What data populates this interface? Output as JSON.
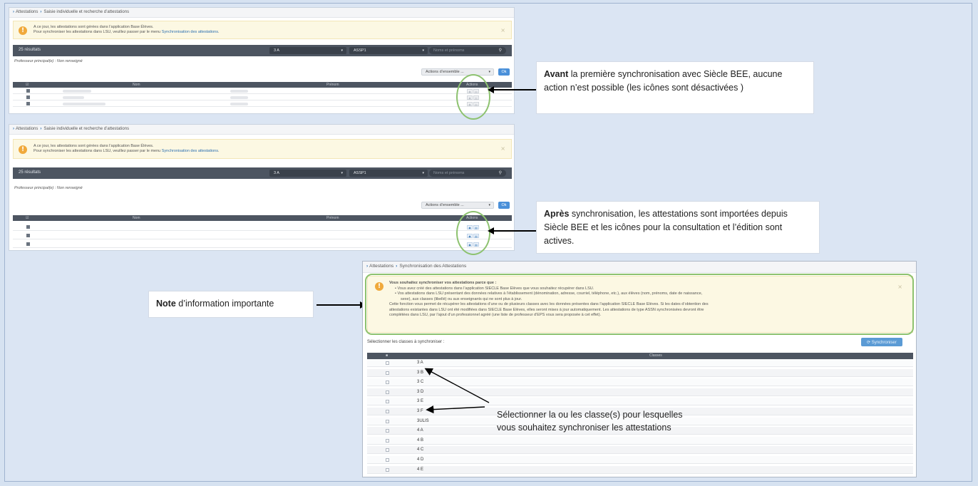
{
  "panel": {
    "breadcrumb_root": "Attestations",
    "breadcrumb_page": "Saisie individuelle et recherche d’attestations",
    "alert_line1": "A ce jour, les attestations sont gérées dans l’application Base Élèves.",
    "alert_line2_prefix": "Pour synchroniser les attestations dans LSU, veuillez passer par le menu",
    "alert_link": "Synchronisation des attestations",
    "results": "25 résultats",
    "class_select": "3 A",
    "program_select": "ASSP1",
    "search_placeholder": "Noms et prénoms",
    "prof": "Professeur principal(e) : Non renseigné",
    "actions_select": "Actions d’ensemble ...",
    "ok_label": "Ok",
    "col_nom": "Nom",
    "col_prenom": "Prénom",
    "col_actions": "Actions"
  },
  "callout_before": {
    "bold": "Avant",
    "text": " la première synchronisation avec Siècle BEE, aucune action n’est possible (les icônes sont désactivées )"
  },
  "callout_after": {
    "bold": "Après",
    "text": " synchronisation, les attestations sont importées depuis Siècle BEE et les icônes pour la consultation et l’édition sont actives."
  },
  "note_label": {
    "bold": "Note",
    "text": " d’information importante"
  },
  "sync": {
    "breadcrumb_root": "Attestations",
    "breadcrumb_page": "Synchronisation des Attestations",
    "alert_title": "Vous souhaitez synchroniser vos attestations parce que :",
    "bullet1": "Vous avez créé des attestations dans l’application SIECLE Base Elèves que vous souhaitez récupérer dans LSU.",
    "bullet2": "Vos attestations dans LSU présentant des données relatives à l’établissement (dénomination, adresse, courriel, téléphone, etc.), aux élèves (nom, prénoms, date de naissance,",
    "bullet2b": "sexe), aux classes (libellé) ou aux enseignants qui ne sont plus à jour.",
    "para1": "Cette fonction vous permet de récupérer les attestations d’une ou de plusieurs classes avec les données présentes dans l’application SIECLE Base Elèves. Si les dates d’obtention des",
    "para2": "attestations existantes dans LSU ont été modifiées dans SIECLE Base Elèves, elles seront mises à jour automatiquement. Les attestations de type ASSN synchronisées devront être",
    "para3": "complétées dans LSU, par l’ajout d’un professionnel agréé (une liste de professeur d’EPS vous sera proposée à cet effet).",
    "select_label": "Sélectionner les classes à synchroniser :",
    "sync_button": "Synchroniser",
    "col_classes": "Classes",
    "classes": [
      "3 A",
      "3 B",
      "3 C",
      "3 D",
      "3 E",
      "3 F",
      "3ULIS",
      "4 A",
      "4 B",
      "4 C",
      "4 D",
      "4 E"
    ]
  },
  "select_note": {
    "line1": "Sélectionner la ou les classe(s) pour lesquelles",
    "line2": "vous souhaitez synchroniser les attestations"
  }
}
